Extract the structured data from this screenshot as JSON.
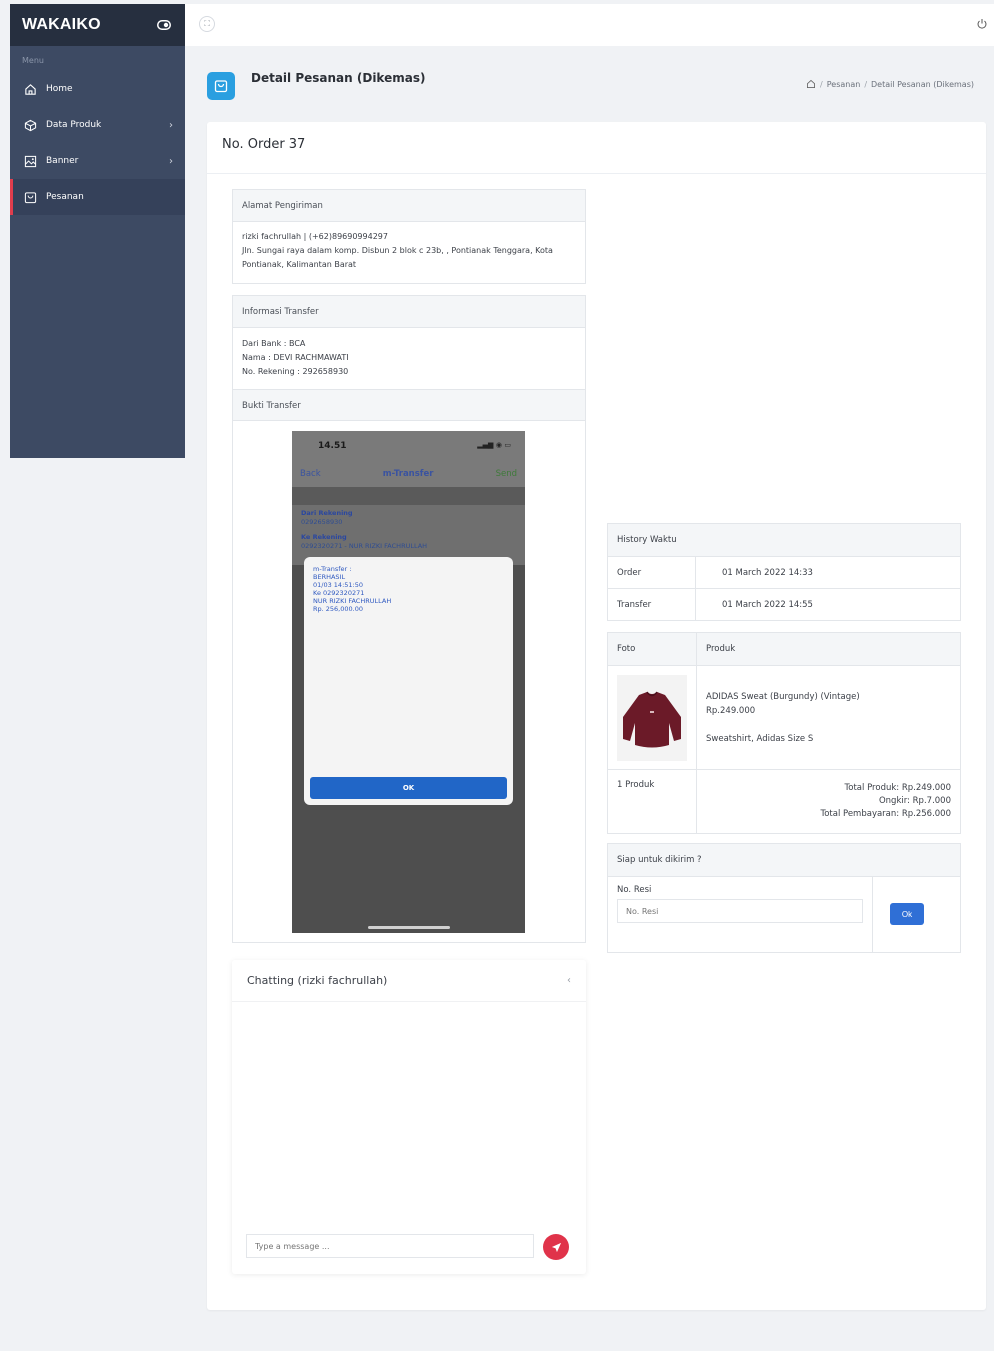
{
  "sidebar": {
    "brand": "WAKAIKO",
    "menu_label": "Menu",
    "items": [
      {
        "label": "Home",
        "icon": "home-icon",
        "has_submenu": false
      },
      {
        "label": "Data Produk",
        "icon": "cube-icon",
        "has_submenu": true
      },
      {
        "label": "Banner",
        "icon": "image-icon",
        "has_submenu": true
      },
      {
        "label": "Pesanan",
        "icon": "shopping-bag-icon",
        "has_submenu": false,
        "active": true
      }
    ]
  },
  "header": {
    "title": "Detail Pesanan (Dikemas)",
    "breadcrumb": [
      "Pesanan",
      "Detail Pesanan (Dikemas)"
    ]
  },
  "order": {
    "title": "No. Order 37"
  },
  "shipping": {
    "header": "Alamat Pengiriman",
    "line1": "rizki fachrullah | (+62)89690994297",
    "line2": "Jln. Sungai raya dalam komp. Disbun 2 blok c 23b, , Pontianak Tenggara, Kota Pontianak, Kalimantan Barat"
  },
  "transfer": {
    "header": "Informasi Transfer",
    "bank": "Dari Bank : BCA",
    "name": "Nama : DEVI RACHMAWATI",
    "account": "No. Rekening : 292658930",
    "proof_header": "Bukti Transfer",
    "proof": {
      "time": "14.51",
      "back": "Back",
      "title": "m-Transfer",
      "send": "Send",
      "from_label": "Dari Rekening",
      "from_value": "0292658930",
      "to_label": "Ke Rekening",
      "to_value": "0292320271 - NUR RIZKI FACHRULLAH",
      "message": [
        "m-Transfer :",
        "BERHASIL",
        "01/03 14:51:50",
        "Ke 0292320271",
        "NUR RIZKI FACHRULLAH",
        "Rp. 256,000.00"
      ],
      "ok": "OK"
    }
  },
  "history": {
    "header": "History Waktu",
    "rows": [
      {
        "label": "Order",
        "value": "01 March 2022 14:33"
      },
      {
        "label": "Transfer",
        "value": "01 March 2022 14:55"
      }
    ]
  },
  "products": {
    "col_photo": "Foto",
    "col_product": "Produk",
    "items": [
      {
        "name": "ADIDAS Sweat (Burgundy) (Vintage)",
        "price": "Rp.249.000",
        "note": "Sweatshirt, Adidas Size S",
        "image_color": "#6b1a28"
      }
    ],
    "count": "1 Produk",
    "total_product": "Total Produk: Rp.249.000",
    "shipping_cost": "Ongkir: Rp.7.000",
    "total_payment": "Total Pembayaran: Rp.256.000"
  },
  "ship_ready": {
    "header": "Siap untuk dikirim ?",
    "label": "No. Resi",
    "placeholder": "No. Resi",
    "button": "Ok"
  },
  "chat": {
    "title": "Chatting (rizki fachrullah)",
    "placeholder": "Type a message ..."
  },
  "colors": {
    "sidebar": "#3d4a63",
    "brand_bar": "#262f3f",
    "accent": "#2a9fe0",
    "send": "#e0334a",
    "ok": "#2f6fd6"
  }
}
